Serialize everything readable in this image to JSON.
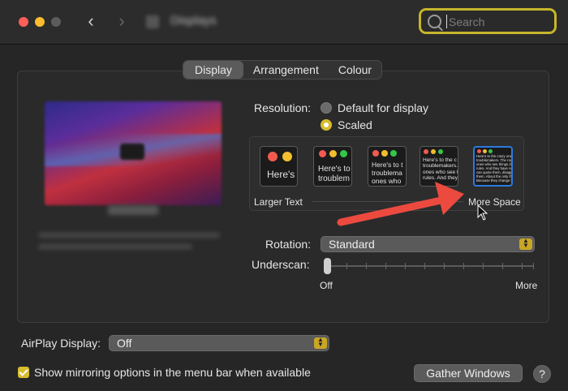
{
  "window": {
    "nav_back": "‹",
    "nav_forward": "›",
    "title": "Displays"
  },
  "search": {
    "placeholder": "Search"
  },
  "tabs": [
    {
      "label": "Display"
    },
    {
      "label": "Arrangement"
    },
    {
      "label": "Colour"
    }
  ],
  "resolution": {
    "label": "Resolution:",
    "options": [
      {
        "label": "Default for display",
        "selected": false
      },
      {
        "label": "Scaled",
        "selected": true
      }
    ]
  },
  "scaled_options": [
    {
      "text": "Here's"
    },
    {
      "text": "Here's to\ntroublem"
    },
    {
      "text": "Here's to t\ntroublema\nones who"
    },
    {
      "text": "Here's to the c\ntroublemakers.\nones who see t\nrules. And they"
    },
    {
      "text": "Here's to the crazy one\ntroublemakers. The rou\nones who see things dif\nrules. And they have no\ncan quote them, disagr\nthem. About the only th\nBecause they change th"
    }
  ],
  "scale_labels": {
    "left": "Larger Text",
    "right": "More Space"
  },
  "rotation": {
    "label": "Rotation:",
    "value": "Standard"
  },
  "underscan": {
    "label": "Underscan:",
    "min_label": "Off",
    "max_label": "More",
    "value": 0
  },
  "airplay": {
    "label": "AirPlay Display:",
    "value": "Off"
  },
  "mirroring": {
    "label": "Show mirroring options in the menu bar when available",
    "checked": true
  },
  "gather_button": "Gather Windows",
  "help_button": "?",
  "colors": {
    "accent": "#d6bd2e",
    "selection_blue": "#2a7be0",
    "annotation_arrow": "#ec4a3f"
  }
}
